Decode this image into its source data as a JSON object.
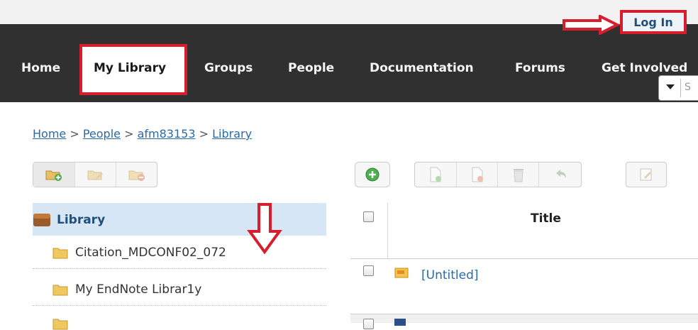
{
  "header": {
    "login_label": "Log In"
  },
  "nav": {
    "items": [
      {
        "label": "Home"
      },
      {
        "label": "My Library"
      },
      {
        "label": "Groups"
      },
      {
        "label": "People"
      },
      {
        "label": "Documentation"
      },
      {
        "label": "Forums"
      },
      {
        "label": "Get Involved"
      }
    ],
    "active_item": "My Library"
  },
  "search": {
    "placeholder": "S"
  },
  "breadcrumb": {
    "items": [
      "Home",
      "People",
      "afm83153",
      "Library"
    ],
    "separator": ">"
  },
  "sidebar": {
    "root_label": "Library",
    "collections": [
      {
        "label": "Citation_MDCONF02_072"
      },
      {
        "label": "My EndNote Librar1y"
      }
    ]
  },
  "items_table": {
    "columns": [
      "Title"
    ],
    "rows": [
      {
        "title": "[Untitled]"
      }
    ]
  },
  "colors": {
    "nav_bg": "#303030",
    "highlight_red": "#d81e2c",
    "link_blue": "#2a6aa8",
    "selected_row": "#d6e6f4"
  }
}
